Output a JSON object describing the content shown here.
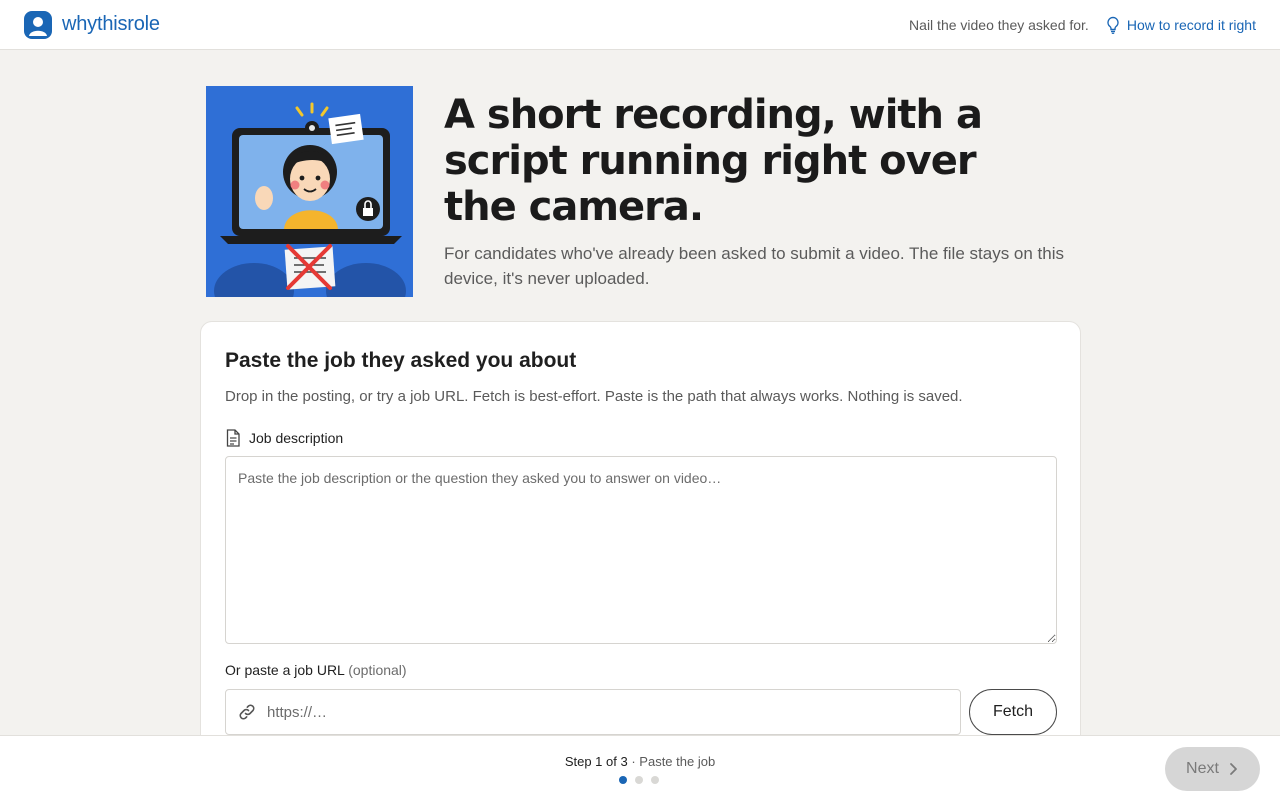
{
  "header": {
    "brand_name": "whythisrole",
    "tagline": "Nail the video they asked for.",
    "howto_label": "How to record it right"
  },
  "hero": {
    "title": "A short recording, with a script running right over the camera.",
    "subtitle": "For candidates who've already been asked to submit a video. The file stays on this device, it's never uploaded."
  },
  "card": {
    "title": "Paste the job they asked you about",
    "description": "Drop in the posting, or try a job URL. Fetch is best-effort. Paste is the path that always works. Nothing is saved.",
    "jd_label": "Job description",
    "jd_placeholder": "Paste the job description or the question they asked you to answer on video…",
    "jd_value": "",
    "url_label": "Or paste a job URL",
    "url_optional": "(optional)",
    "url_placeholder": "https://…",
    "url_value": "",
    "fetch_label": "Fetch"
  },
  "footer": {
    "step_prefix": "Step 1 of 3",
    "step_sep": "·",
    "step_name": "Paste the job",
    "step_total": 3,
    "step_current": 1,
    "next_label": "Next"
  },
  "colors": {
    "accent": "#1a66b5",
    "background": "#f3f2ef",
    "illustration_bg": "#2f6fd6",
    "next_disabled": "#d6d6d6"
  },
  "icons": {
    "brand": "user-avatar-icon",
    "howto": "lightbulb-icon",
    "jd": "document-icon",
    "url": "link-icon",
    "next": "chevron-right-icon"
  }
}
